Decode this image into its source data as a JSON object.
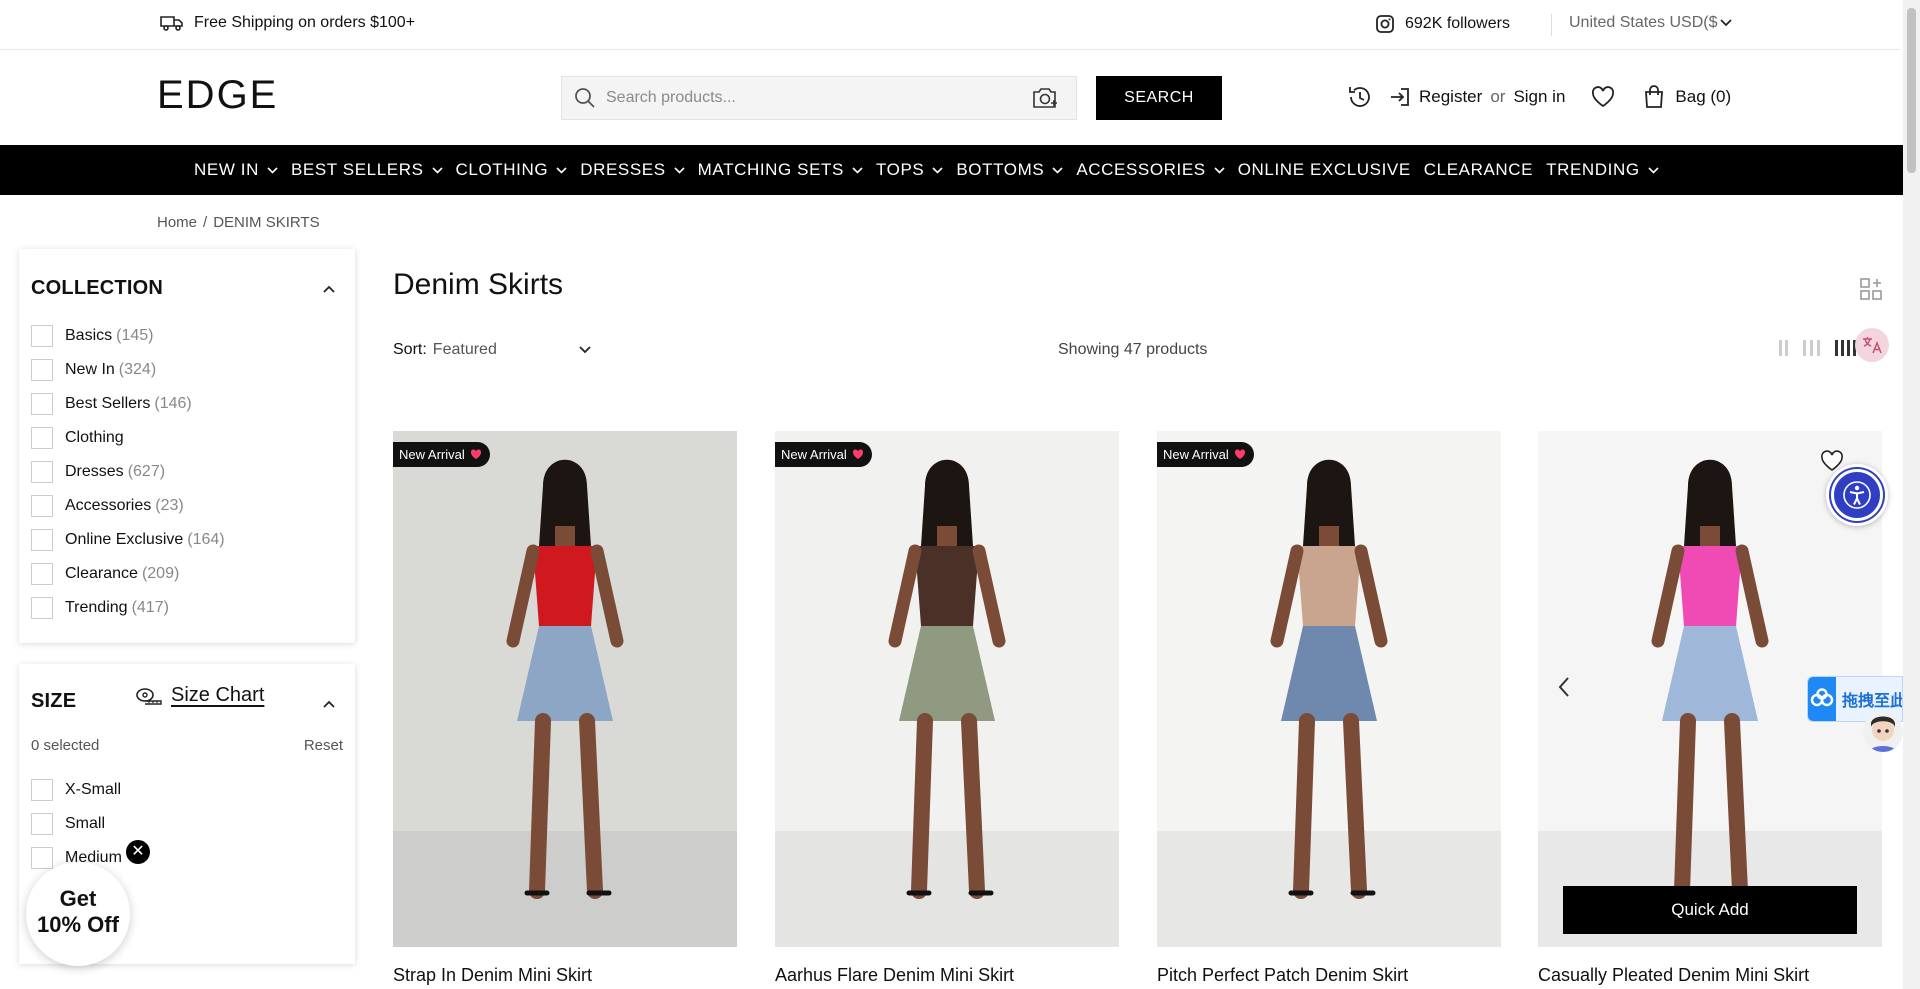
{
  "topbar": {
    "shipping_text": "Free Shipping on orders $100+",
    "followers_text": "692K followers",
    "currency_text": "United States USD($"
  },
  "header": {
    "logo": "EDGE",
    "search_placeholder": "Search products...",
    "search_button": "SEARCH",
    "register": "Register",
    "or": "or",
    "sign_in": "Sign in",
    "bag": "Bag (0)"
  },
  "nav": {
    "items": [
      {
        "label": "NEW IN",
        "dropdown": true
      },
      {
        "label": "BEST SELLERS",
        "dropdown": true
      },
      {
        "label": "CLOTHING",
        "dropdown": true
      },
      {
        "label": "DRESSES",
        "dropdown": true
      },
      {
        "label": "MATCHING SETS",
        "dropdown": true
      },
      {
        "label": "TOPS",
        "dropdown": true
      },
      {
        "label": "BOTTOMS",
        "dropdown": true
      },
      {
        "label": "ACCESSORIES",
        "dropdown": true
      },
      {
        "label": "ONLINE EXCLUSIVE",
        "dropdown": false
      },
      {
        "label": "CLEARANCE",
        "dropdown": false
      },
      {
        "label": "TRENDING",
        "dropdown": true
      }
    ]
  },
  "breadcrumb": {
    "home": "Home",
    "separator": "/",
    "current": "DENIM SKIRTS"
  },
  "sidebar": {
    "collection": {
      "title": "COLLECTION",
      "items": [
        {
          "label": "Basics",
          "count": "(145)"
        },
        {
          "label": "New In",
          "count": "(324)"
        },
        {
          "label": "Best Sellers",
          "count": "(146)"
        },
        {
          "label": "Clothing",
          "count": ""
        },
        {
          "label": "Dresses",
          "count": "(627)"
        },
        {
          "label": "Accessories",
          "count": "(23)"
        },
        {
          "label": "Online Exclusive",
          "count": "(164)"
        },
        {
          "label": "Clearance",
          "count": "(209)"
        },
        {
          "label": "Trending",
          "count": "(417)"
        }
      ]
    },
    "size": {
      "title": "SIZE",
      "size_chart": "Size Chart",
      "selected": "0 selected",
      "reset": "Reset",
      "items": [
        {
          "label": "X-Small"
        },
        {
          "label": "Small"
        },
        {
          "label": "Medium"
        }
      ]
    }
  },
  "promo": {
    "line1": "Get",
    "line2": "10% Off",
    "close": "✕"
  },
  "main": {
    "title": "Denim Skirts",
    "sort_label": "Sort:",
    "sort_value": "Featured",
    "showing": "Showing 47 products"
  },
  "products": [
    {
      "name": "Strap In Denim Mini Skirt",
      "badge": "New Arrival",
      "top_color": "#d0191f",
      "skirt_color": "#8ea6c5",
      "bg": "#d9d9d6"
    },
    {
      "name": "Aarhus Flare Denim Mini Skirt",
      "badge": "New Arrival",
      "top_color": "#4a3027",
      "skirt_color": "#8f9a80",
      "bg": "#f1f1f0"
    },
    {
      "name": "Pitch Perfect Patch Denim Skirt",
      "badge": "New Arrival",
      "top_color": "#c9a48f",
      "skirt_color": "#6f88ad",
      "bg": "#f4f4f3"
    },
    {
      "name": "Casually Pleated Denim Mini Skirt",
      "badge": "",
      "top_color": "#f04bb4",
      "skirt_color": "#9fb7d8",
      "bg": "#f5f5f5",
      "quick_add": "Quick Add"
    }
  ],
  "floating": {
    "drag_text": "拖拽至此"
  }
}
